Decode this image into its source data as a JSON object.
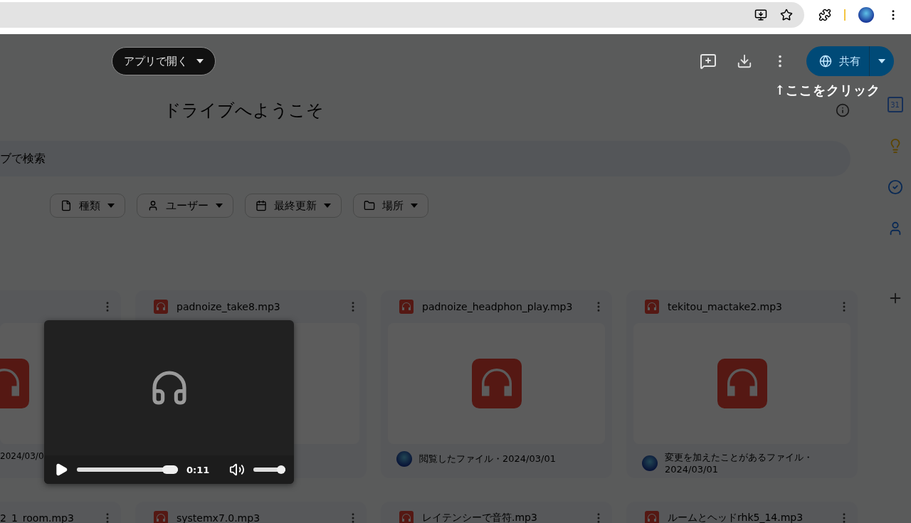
{
  "viewer_header": {
    "open_with": "アプリで開く",
    "share": "共有"
  },
  "annotation": "↑ここをクリック",
  "drive": {
    "title": "ドライブへようこそ",
    "search_placeholder": "ブで検索",
    "filters": [
      {
        "label": "種類",
        "kind": "type"
      },
      {
        "label": "ユーザー",
        "kind": "person"
      },
      {
        "label": "最終更新",
        "kind": "date"
      },
      {
        "label": "場所",
        "kind": "folder"
      }
    ],
    "files": [
      {
        "kind": "partial",
        "meta": "2024/03/0"
      },
      {
        "kind": "card",
        "title": "padnoize_take8.mp3"
      },
      {
        "kind": "card",
        "title": "padnoize_headphon_play.mp3",
        "meta": "閲覧したファイル・2024/03/01"
      },
      {
        "kind": "card",
        "title": "tekitou_mactake2.mp3",
        "meta": "変更を加えたことがあるファイル・2024/03/01"
      },
      {
        "kind": "partial",
        "title": "2_1_room.mp3"
      },
      {
        "kind": "card",
        "title": "systemx7.0.mp3"
      },
      {
        "kind": "card",
        "title": "レイテンシーで音符.mp3"
      },
      {
        "kind": "card",
        "title": "ルームとヘッドrhk5_14.mp3"
      }
    ],
    "calendar_day": "31"
  },
  "player": {
    "time": "0:11",
    "progress": {
      "level": 1
    },
    "volume": {
      "level": 1
    }
  }
}
